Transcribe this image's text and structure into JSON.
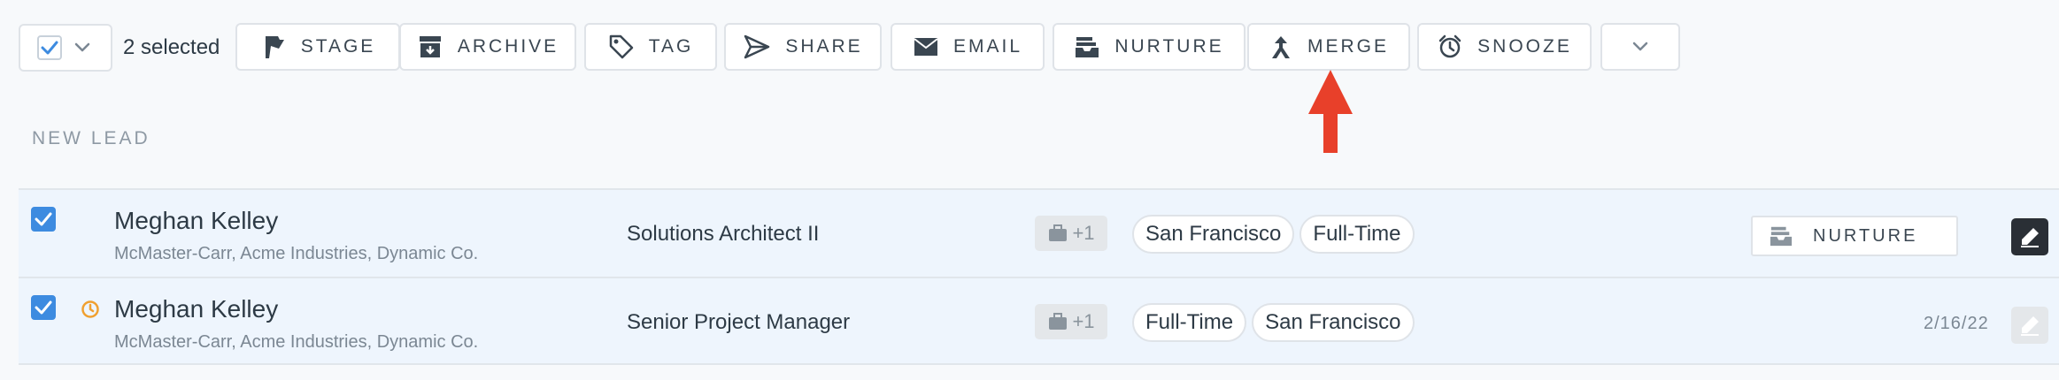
{
  "toolbar": {
    "selected_count": "2 selected",
    "buttons": [
      {
        "label": "STAGE",
        "icon": "flag-icon"
      },
      {
        "label": "ARCHIVE",
        "icon": "archive-box-icon"
      },
      {
        "label": "TAG",
        "icon": "tag-icon"
      },
      {
        "label": "SHARE",
        "icon": "share-send-icon"
      },
      {
        "label": "EMAIL",
        "icon": "envelope-icon"
      },
      {
        "label": "NURTURE",
        "icon": "nurture-inbox-icon"
      },
      {
        "label": "MERGE",
        "icon": "merge-arrow-icon"
      },
      {
        "label": "SNOOZE",
        "icon": "alarm-clock-icon"
      }
    ],
    "more_icon": "chevron-down-icon"
  },
  "section": {
    "title": "NEW LEAD"
  },
  "rows": [
    {
      "name": "Meghan Kelley",
      "companies": "McMaster-Carr, Acme Industries, Dynamic Co.",
      "job_title": "Solutions Architect II",
      "jobs_badge": "+1",
      "tags": [
        "San Francisco",
        "Full-Time"
      ],
      "stage_label": "NURTURE",
      "checked": true,
      "snoozed": false
    },
    {
      "name": "Meghan Kelley",
      "companies": "McMaster-Carr, Acme Industries, Dynamic Co.",
      "job_title": "Senior Project Manager",
      "jobs_badge": "+1",
      "tags": [
        "Full-Time",
        "San Francisco"
      ],
      "date": "2/16/22",
      "checked": true,
      "snoozed": true
    }
  ],
  "colors": {
    "accent": "#3d8be0",
    "annotation": "#e8402a",
    "snooze": "#f0a030"
  }
}
